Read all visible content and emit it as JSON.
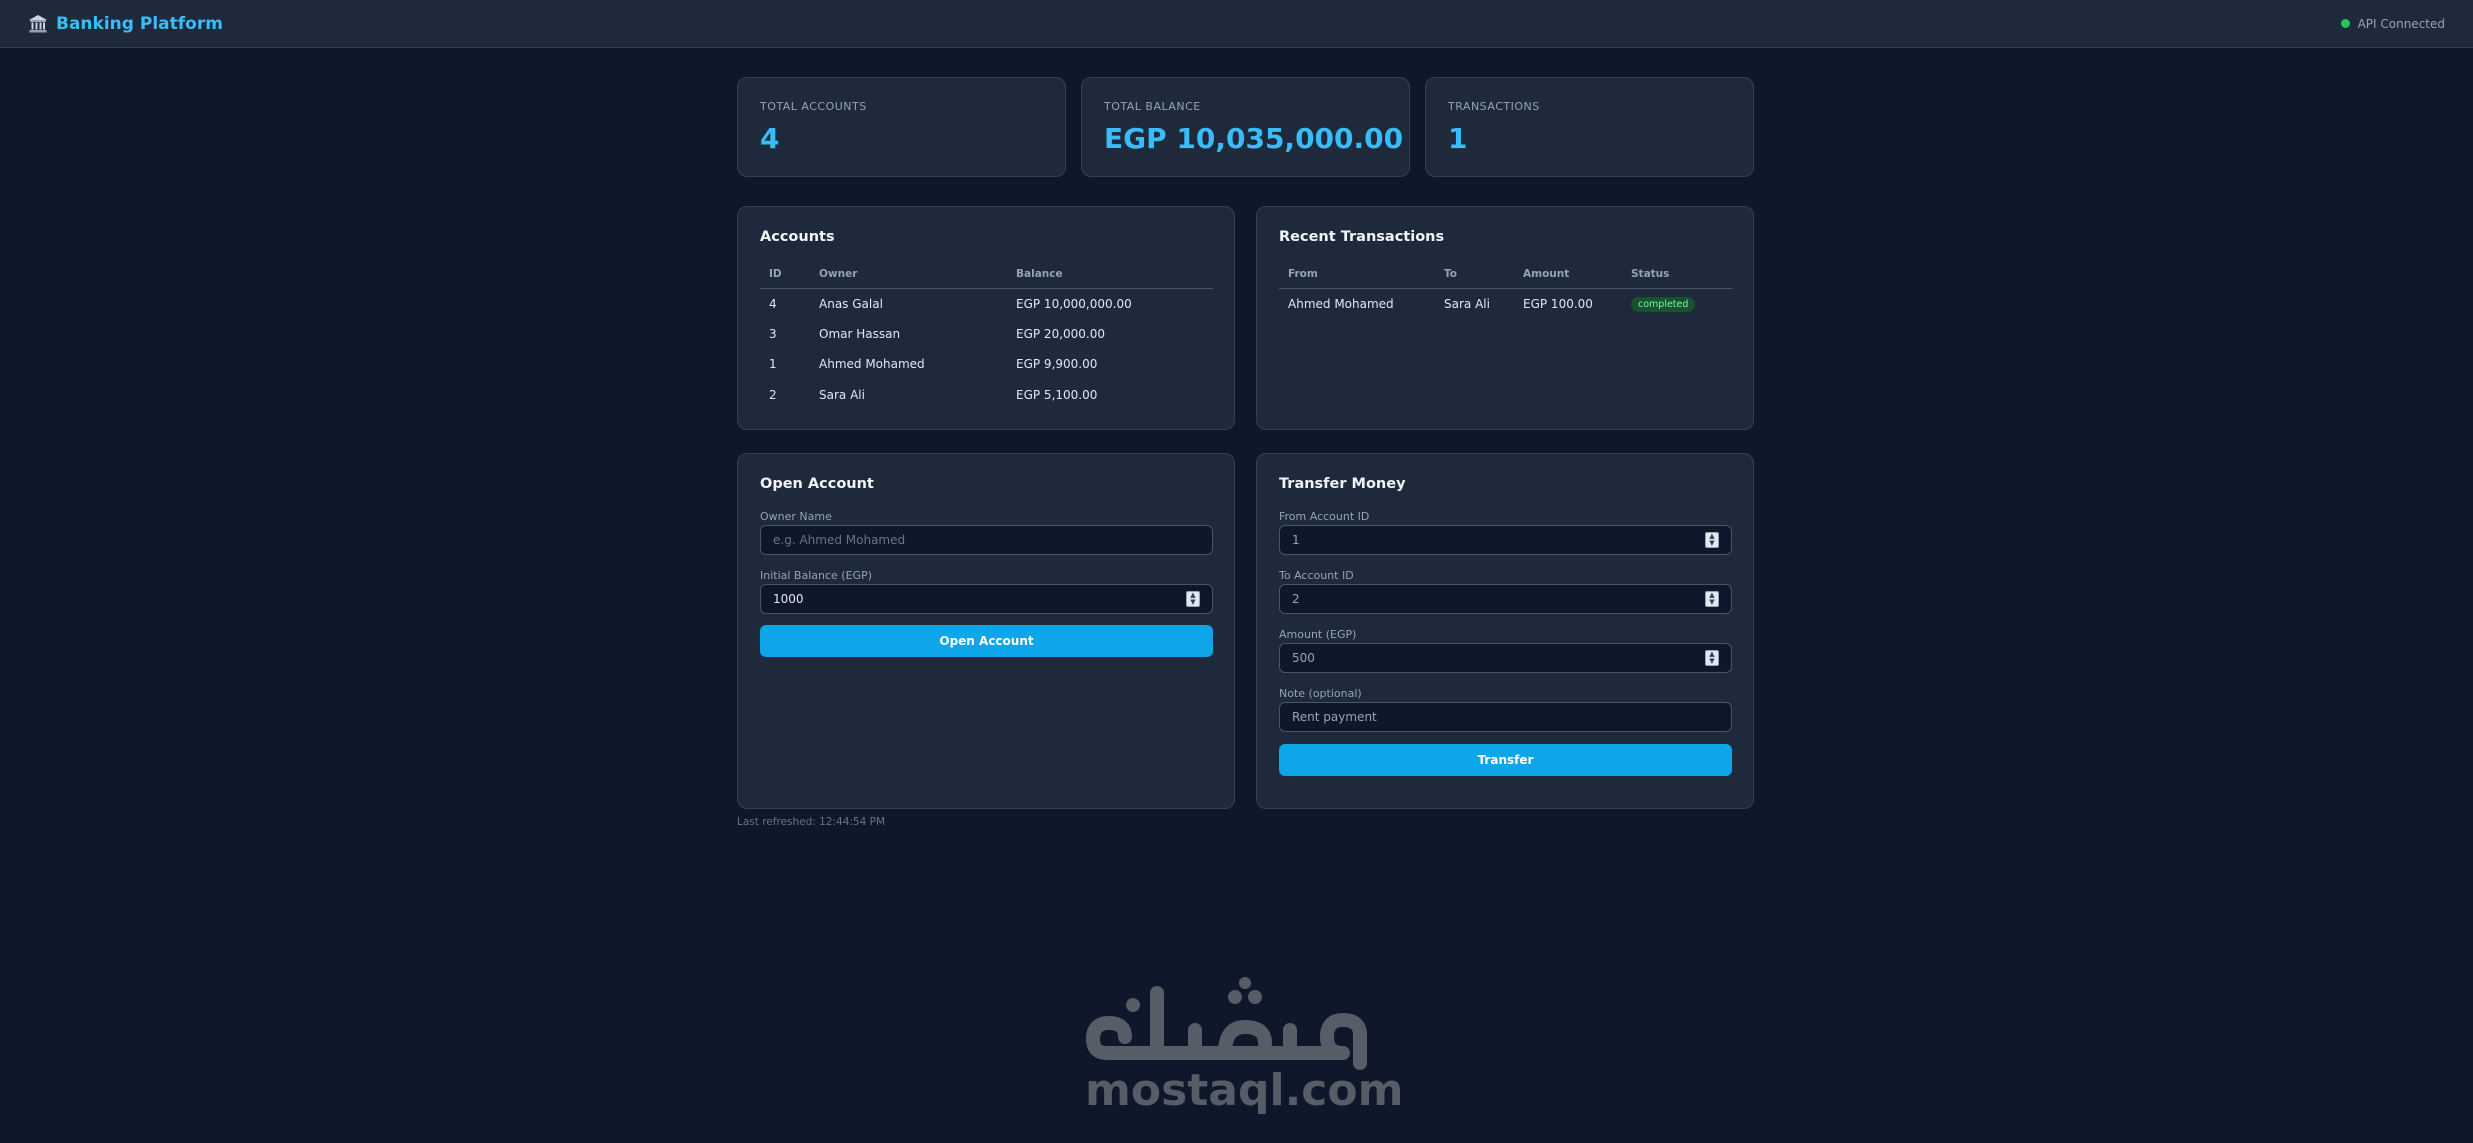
{
  "header": {
    "title": "Banking Platform",
    "brand_icon": "bank-icon",
    "status_text": "API Connected",
    "status_color": "#22c55e",
    "accent": "#38bdf8"
  },
  "stats": [
    {
      "label": "Total Accounts",
      "value": "4"
    },
    {
      "label": "Total Balance",
      "value": "EGP 10,035,000.00"
    },
    {
      "label": "Transactions",
      "value": "1"
    }
  ],
  "accounts": {
    "title": "Accounts",
    "columns": [
      "ID",
      "Owner",
      "Balance"
    ],
    "rows": [
      {
        "id": "4",
        "owner": "Anas Galal",
        "balance": "EGP 10,000,000.00"
      },
      {
        "id": "3",
        "owner": "Omar Hassan",
        "balance": "EGP 20,000.00"
      },
      {
        "id": "1",
        "owner": "Ahmed Mohamed",
        "balance": "EGP 9,900.00"
      },
      {
        "id": "2",
        "owner": "Sara Ali",
        "balance": "EGP 5,100.00"
      }
    ]
  },
  "transactions": {
    "title": "Recent Transactions",
    "columns": [
      "From",
      "To",
      "Amount",
      "Status"
    ],
    "rows": [
      {
        "from": "Ahmed Mohamed",
        "to": "Sara Ali",
        "amount": "EGP 100.00",
        "status": "completed"
      }
    ]
  },
  "open_account": {
    "title": "Open Account",
    "owner_label": "Owner Name",
    "owner_placeholder": "e.g. Ahmed Mohamed",
    "balance_label": "Initial Balance (EGP)",
    "balance_value": "1000",
    "button": "Open Account"
  },
  "transfer": {
    "title": "Transfer Money",
    "from_label": "From Account ID",
    "from_placeholder": "1",
    "to_label": "To Account ID",
    "to_placeholder": "2",
    "amount_label": "Amount (EGP)",
    "amount_placeholder": "500",
    "note_label": "Note (optional)",
    "note_placeholder": "Rent payment",
    "button": "Transfer"
  },
  "footer": {
    "last_refreshed": "Last refreshed: 12:44:54 PM"
  },
  "watermark": {
    "arabic": "مستقل",
    "latin": "mostaql.com"
  }
}
